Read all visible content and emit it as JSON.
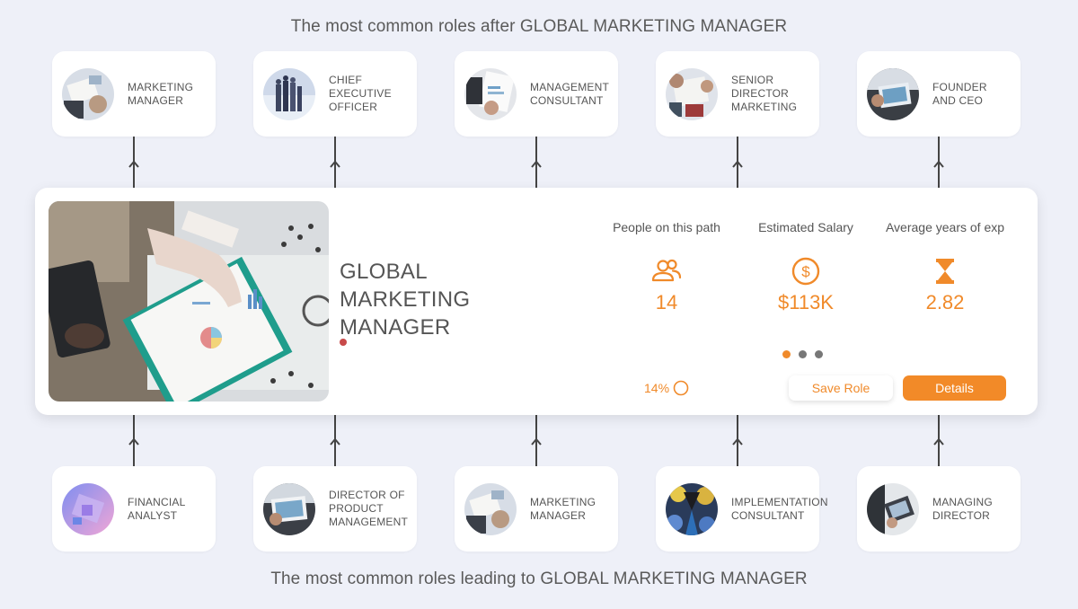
{
  "headings": {
    "next_roles": "The most common roles after GLOBAL MARKETING MANAGER",
    "previous_roles": "The most common roles leading to GLOBAL MARKETING MANAGER"
  },
  "next_roles": [
    {
      "label": "MARKETING MANAGER"
    },
    {
      "label": "CHIEF EXECUTIVE OFFICER"
    },
    {
      "label": "MANAGEMENT CONSULTANT"
    },
    {
      "label": "SENIOR DIRECTOR MARKETING"
    },
    {
      "label": "FOUNDER AND CEO"
    }
  ],
  "previous_roles": [
    {
      "label": "FINANCIAL ANALYST"
    },
    {
      "label": "DIRECTOR OF PRODUCT MANAGEMENT"
    },
    {
      "label": "MARKETING MANAGER"
    },
    {
      "label": "IMPLEMENTATION CONSULTANT"
    },
    {
      "label": "MANAGING DIRECTOR"
    }
  ],
  "current_role": {
    "title": "GLOBAL MARKETING MANAGER",
    "stats": [
      {
        "label": "People on this path",
        "value": "14",
        "icon": "people-icon"
      },
      {
        "label": "Estimated Salary",
        "value": "$113K",
        "icon": "dollar-icon"
      },
      {
        "label": "Average years of exp",
        "value": "2.82",
        "icon": "hourglass-icon"
      }
    ],
    "progress": "14%",
    "pager": {
      "count": 3,
      "active": 1
    },
    "save_label": "Save Role",
    "details_label": "Details"
  },
  "colors": {
    "accent": "#f08a2a",
    "background": "#eef0f8",
    "title_dot": "#c84a4a"
  }
}
